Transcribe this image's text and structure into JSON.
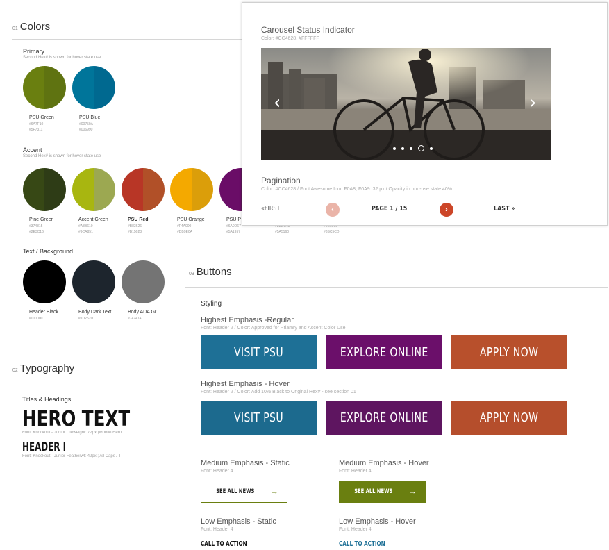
{
  "colors": {
    "num": "01",
    "title": "Colors",
    "primary": {
      "title": "Primary",
      "note": "Second Hex# is shown for hover state use",
      "swatches": [
        {
          "name": "PSU Green",
          "hex1": "#6A7F10",
          "hex2": "#5F7311",
          "left": "#6A7F10",
          "right": "#5F7311"
        },
        {
          "name": "PSU Blue",
          "hex1": "#00759A",
          "hex2": "#006990",
          "left": "#00759A",
          "right": "#006990"
        }
      ]
    },
    "accent": {
      "title": "Accent",
      "note": "Second Hex# is shown for hover state use",
      "swatches": [
        {
          "name": "Pine Green",
          "hex1": "#374815",
          "hex2": "#2E3C16",
          "left": "#374815",
          "right": "#2E3C16"
        },
        {
          "name": "Accent Green",
          "hex1": "#A8B610",
          "hex2": "#9CA851",
          "left": "#A8B610",
          "right": "#9CA851"
        },
        {
          "name": "PSU Red",
          "hex1": "#B83626",
          "hex2": "#B15028",
          "left": "#B83626",
          "right": "#B15028"
        },
        {
          "name": "PSU Orange",
          "hex1": "#F4A900",
          "hex2": "#DB9E0A",
          "left": "#F4A900",
          "right": "#DB9E0A"
        },
        {
          "name": "PSU P",
          "hex1": "#6A0D67",
          "hex2": "#5A1957",
          "left": "#6A0D67",
          "right": "#5A1957"
        }
      ],
      "hidden_hex": [
        {
          "hex1": "#3BD5FD",
          "hex2": "#5A5160"
        },
        {
          "hex1": "#4E6660",
          "hex2": "#8SC5CD"
        }
      ]
    },
    "text_bg": {
      "title": "Text / Background",
      "swatches": [
        {
          "name": "Header Black",
          "hex1": "#000000",
          "color": "#000000"
        },
        {
          "name": "Body Dark Text",
          "hex1": "#1D252D",
          "color": "#1D252D"
        },
        {
          "name": "Body ADA Gr",
          "hex1": "#747474",
          "color": "#747474"
        }
      ]
    }
  },
  "typography": {
    "num": "02",
    "title": "Typography",
    "subtitle": "Titles & Headings",
    "hero": "HERO TEXT",
    "hero_note": "Font: Knockout - Junior Liteweight: 72px (Mobile Hero",
    "header1": "HEADER I",
    "header1_note": "Font: Knockout - Junior Featherwt: 42px ; All Caps / T"
  },
  "carousel": {
    "title": "Carousel Status Indicator",
    "color_note": "Color: #CC4628, #FFFFFF",
    "prev_icon": "chevron-left",
    "next_icon": "chevron-right",
    "dots": 5,
    "active_dot": 4,
    "pagination_title": "Pagination",
    "pagination_note": "Color: #CC4628 / Font Awesome Icon F0A8, F0A9: 32 px / Opacity in non-use state 40%",
    "first": "«FIRST",
    "page": "PAGE 1 / 15",
    "last": "LAST »",
    "accent": "#CC4628"
  },
  "buttons": {
    "num": "03",
    "title": "Buttons",
    "styling": "Styling",
    "regular_title": "Highest Emphasis -Regular",
    "regular_note": "Font: Header 2 / Color: Approved for Priamry and Accent Color Use",
    "hover_title": "Highest Emphasis - Hover",
    "hover_note": "Font: Header 2 / Color: Add 10% Black to Original Hex# - see section 01",
    "regular": [
      {
        "label": "VISIT PSU",
        "color": "#1E7096"
      },
      {
        "label": "EXPLORE ONLINE",
        "color": "#6B0F6A"
      },
      {
        "label": "APPLY NOW",
        "color": "#B8502C"
      }
    ],
    "hover": [
      {
        "label": "VISIT PSU",
        "color": "#1C6A8E"
      },
      {
        "label": "EXPLORE ONLINE",
        "color": "#5E1560"
      },
      {
        "label": "APPLY NOW",
        "color": "#B54E2C"
      }
    ],
    "medium_static_title": "Medium Emphasis - Static",
    "medium_static_note": "Font: Header 4",
    "medium_hover_title": "Medium Emphasis - Hover",
    "medium_hover_note": "Font: Header 4",
    "see_all_news": "SEE ALL NEWS",
    "arrow": "→",
    "medium_green": "#6A7F10",
    "low_static_title": "Low Emphasis - Static",
    "low_static_note": "Font: Header 4",
    "low_hover_title": "Low Emphasis - Hover",
    "low_hover_note": "Font: Header 4",
    "cta": "CALL TO ACTION",
    "cta_hover_color": "#1E7096"
  }
}
